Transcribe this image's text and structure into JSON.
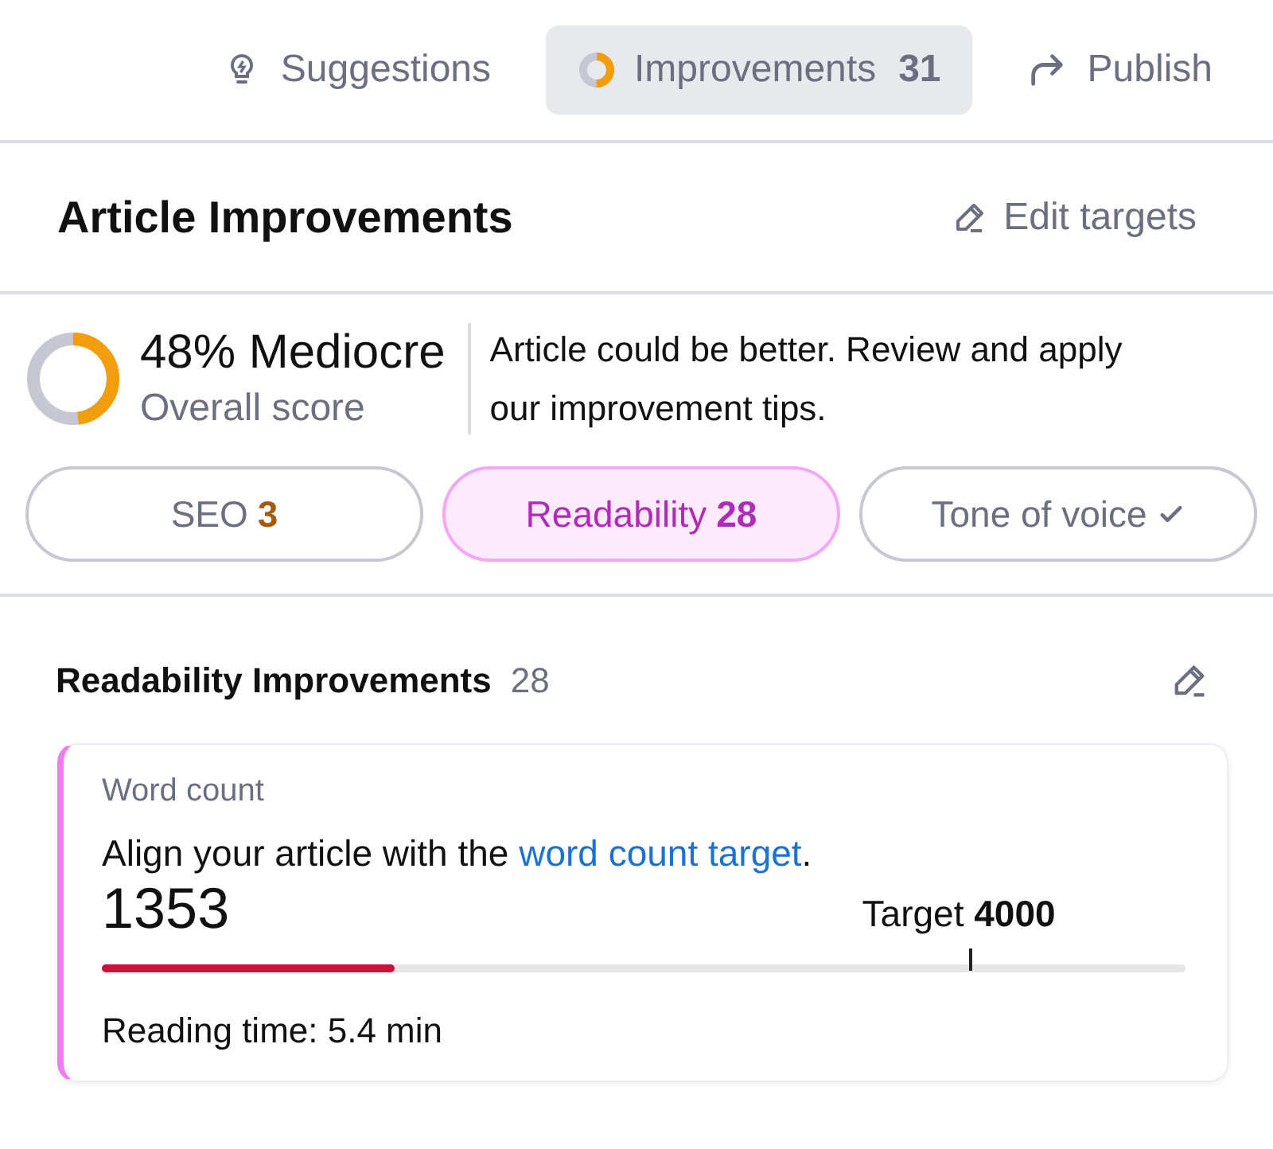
{
  "tabs": [
    {
      "label": "Suggestions",
      "kind": "bulb",
      "selected": false
    },
    {
      "label": "Improvements",
      "kind": "ring",
      "count": "31",
      "selected": true
    },
    {
      "label": "Publish",
      "kind": "share",
      "selected": false
    }
  ],
  "header": {
    "title": "Article Improvements",
    "action": "Edit targets"
  },
  "score": {
    "value": "48% Mediocre",
    "caption": "Overall score",
    "description": "Article could be better. Review and apply our improvement tips."
  },
  "categories": [
    {
      "label": "SEO",
      "kind": "count",
      "count": "3",
      "color": "#a65a10",
      "selected": false
    },
    {
      "label": "Readability",
      "kind": "count",
      "count": "28",
      "color": "#b02cb8",
      "selected": true
    },
    {
      "label": "Tone of voice",
      "kind": "done",
      "selected": false
    }
  ],
  "section": {
    "title": "Readability Improvements",
    "count": "28"
  },
  "card": {
    "title": "Word count",
    "text_before": "Align your article with the ",
    "link": "word count target",
    "text_after": ".",
    "value": "1353",
    "target_label": "Target",
    "target_value": "4000",
    "level": 0.27,
    "target_marker": {
      "level": 0.8
    },
    "reading_time": "Reading time: 5.4 min"
  }
}
